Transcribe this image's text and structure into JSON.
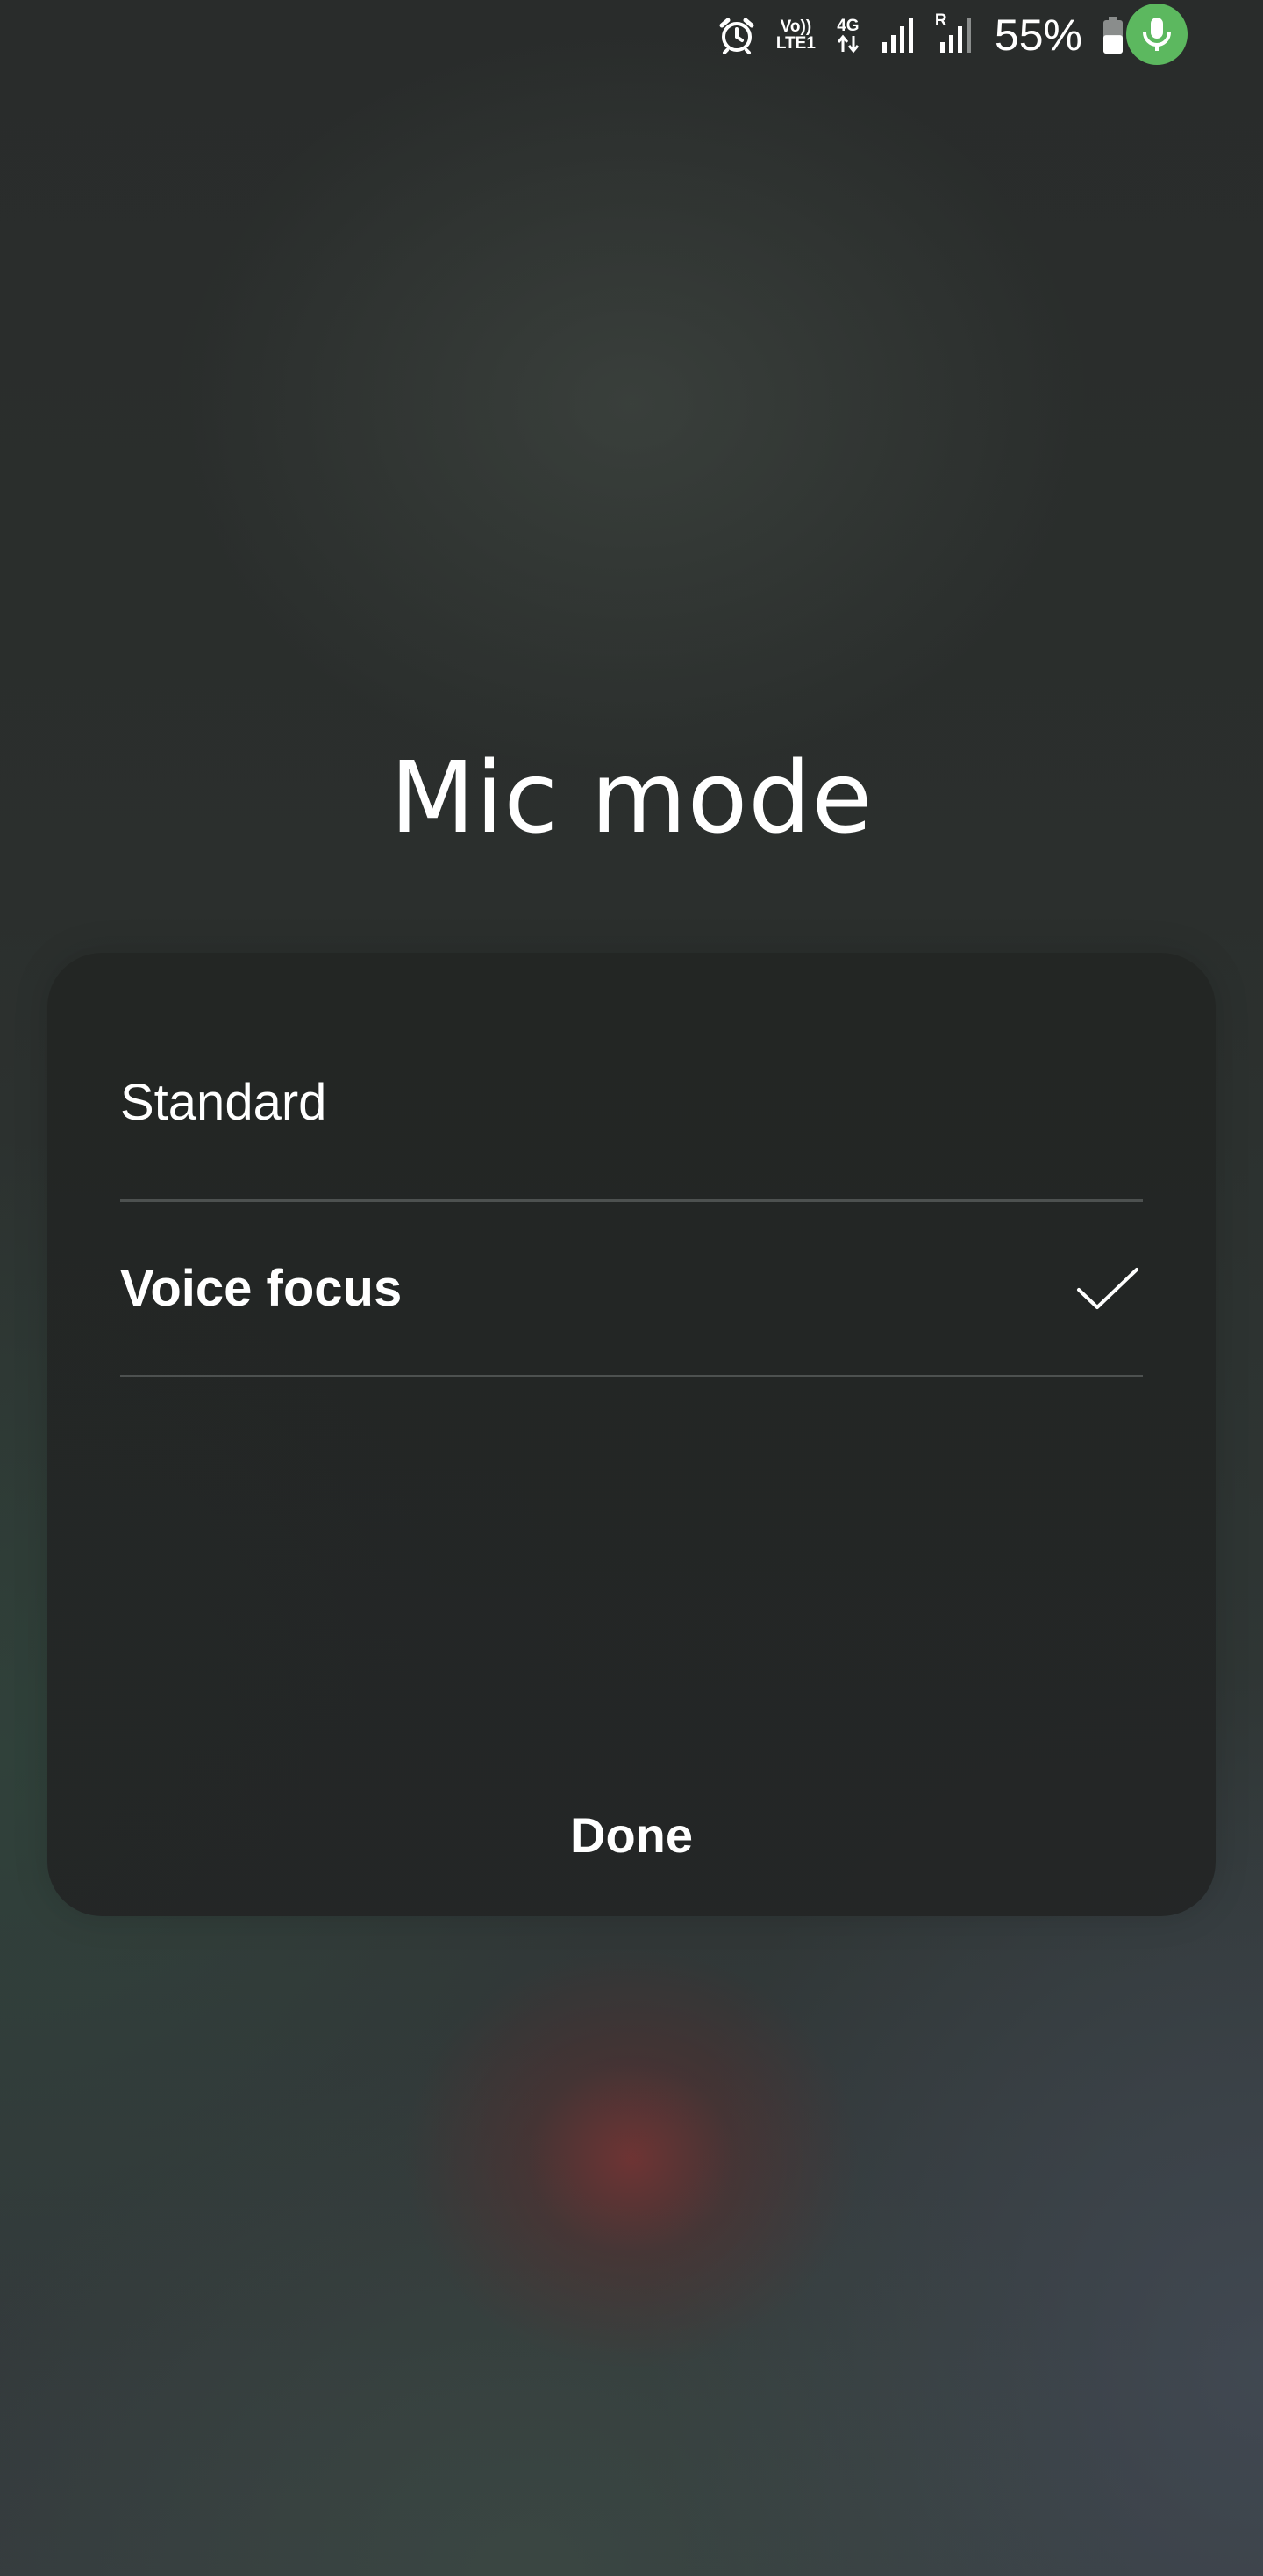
{
  "status_bar": {
    "icons": [
      "alarm-icon",
      "volte-icon",
      "4g-data-icon",
      "signal-icon",
      "roaming-signal-icon",
      "battery-icon",
      "mic-in-use-icon"
    ],
    "volte_line1": "Vo))",
    "volte_line2": "LTE1",
    "network_label": "4G",
    "roaming_label": "R",
    "battery_percent": "55%",
    "battery_level": 0.55,
    "mic_indicator_color": "#5cb85f"
  },
  "dialog": {
    "title": "Mic mode",
    "options": [
      {
        "label": "Standard",
        "selected": false
      },
      {
        "label": "Voice focus",
        "selected": true,
        "icon": "check-icon"
      }
    ],
    "done_label": "Done"
  }
}
